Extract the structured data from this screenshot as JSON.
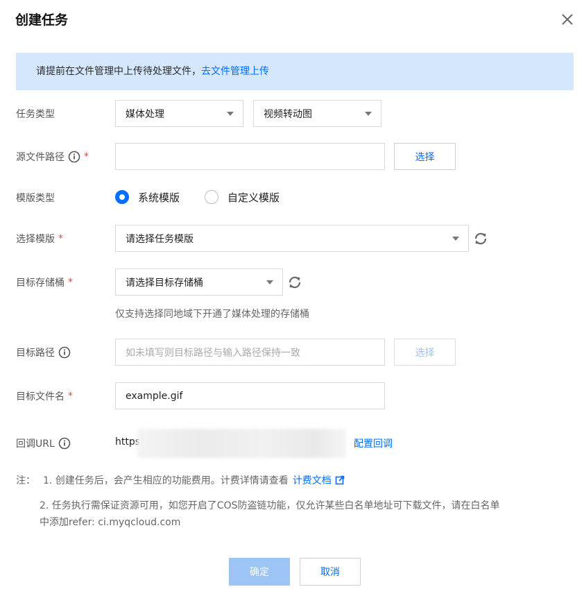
{
  "dialog": {
    "title": "创建任务",
    "close_icon": "close-icon"
  },
  "banner": {
    "text": "请提前在文件管理中上传待处理文件，",
    "link": "去文件管理上传"
  },
  "task_type": {
    "label": "任务类型",
    "primary_value": "媒体处理",
    "secondary_value": "视频转动图"
  },
  "source_path": {
    "label": "源文件路径",
    "value": "",
    "select_button": "选择"
  },
  "template_type": {
    "label": "模版类型",
    "options": [
      {
        "label": "系统模版",
        "checked": true
      },
      {
        "label": "自定义模版",
        "checked": false
      }
    ]
  },
  "select_template": {
    "label": "选择模版",
    "value": "请选择任务模版"
  },
  "target_bucket": {
    "label": "目标存储桶",
    "value": "请选择目标存储桶",
    "hint": "仅支持选择同地域下开通了媒体处理的存储桶"
  },
  "target_path": {
    "label": "目标路径",
    "placeholder": "如未填写则目标路径与输入路径保持一致",
    "select_button": "选择"
  },
  "target_filename": {
    "label": "目标文件名",
    "value": "example.gif"
  },
  "callback": {
    "label": "回调URL",
    "value": "https",
    "link": "配置回调"
  },
  "notes": {
    "prefix": "注：",
    "line1": "1. 创建任务后，会产生相应的功能费用。计费详情请查看",
    "line1_link": "计费文档",
    "line2a": "2. 任务执行需保证资源可用，如您开启了COS防盗链功能，仅允许某些白名单地址可下载文件，请在白名单",
    "line2b": "中添加refer: ci.myqcloud.com"
  },
  "footer": {
    "confirm": "确定",
    "cancel": "取消"
  },
  "colors": {
    "accent": "#006eff",
    "banner_bg": "#d5e7fd",
    "required": "#e54545",
    "disabled_button": "#9cc4f5"
  }
}
